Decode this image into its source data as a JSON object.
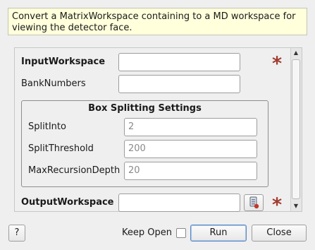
{
  "description": "Convert a MatrixWorkspace containing to a MD workspace for viewing the detector face.",
  "form": {
    "input_workspace": {
      "label": "InputWorkspace",
      "value": ""
    },
    "bank_numbers": {
      "label": "BankNumbers",
      "value": ""
    },
    "box_splitting": {
      "title": "Box Splitting Settings",
      "split_into": {
        "label": "SplitInto",
        "placeholder": "2"
      },
      "split_threshold": {
        "label": "SplitThreshold",
        "placeholder": "200"
      },
      "max_recursion_depth": {
        "label": "MaxRecursionDepth",
        "placeholder": "20"
      }
    },
    "output_workspace": {
      "label": "OutputWorkspace",
      "value": ""
    },
    "required_marker": "*"
  },
  "footer": {
    "help_label": "?",
    "keep_open_label": "Keep Open",
    "keep_open_checked": false,
    "run_label": "Run",
    "close_label": "Close"
  },
  "colors": {
    "description_bg": "#ffffdc",
    "required_star": "#a13b2e",
    "default_button_border": "#5c88c2"
  },
  "icons": {
    "output_browse": "workspace-browse-icon",
    "scroll_up": "arrow-up-icon",
    "scroll_down": "arrow-down-icon"
  }
}
